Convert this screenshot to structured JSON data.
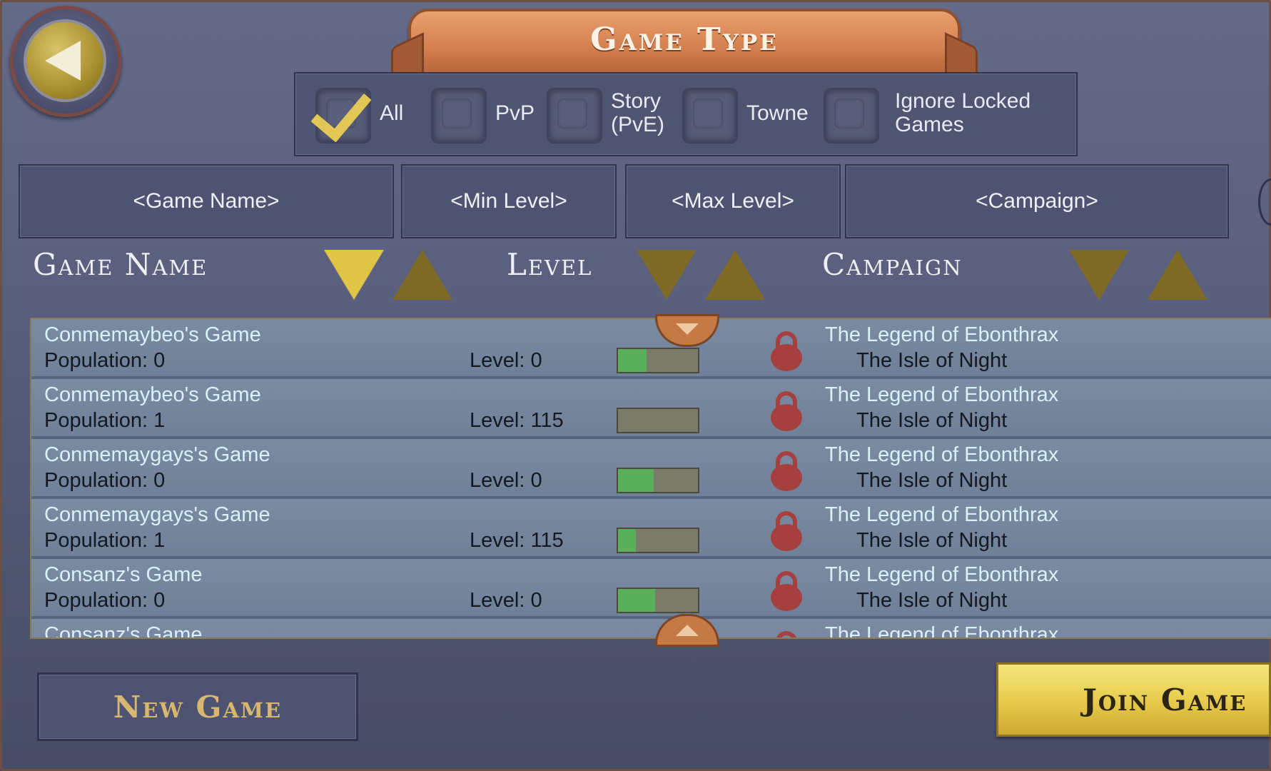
{
  "banner": {
    "title": "Game Type"
  },
  "filters": [
    {
      "label": "All",
      "checked": true
    },
    {
      "label": "PvP",
      "checked": false
    },
    {
      "label": "Story\n(PvE)",
      "checked": false
    },
    {
      "label": "Towne",
      "checked": false
    },
    {
      "label": "Ignore Locked\nGames",
      "checked": false
    }
  ],
  "search": {
    "game_name": "<Game Name>",
    "min_level": "<Min Level>",
    "max_level": "<Max Level>",
    "campaign": "<Campaign>"
  },
  "columns": {
    "game_name": "Game Name",
    "level": "Level",
    "campaign": "Campaign"
  },
  "colors": {
    "accent_gold": "#e0c445",
    "banner_orange": "#d68150",
    "row_bg": "#7485a0",
    "bar_fill": "#5caf5a",
    "lock": "#a5403e"
  },
  "games": [
    {
      "name": "Conmemaybeo's Game",
      "population": "Population: 0",
      "level": "Level: 0",
      "level_fill": 0.36,
      "campaign": "The Legend of Ebonthrax",
      "sub": "The Isle of Night",
      "locked": true
    },
    {
      "name": "Conmemaybeo's Game",
      "population": "Population: 1",
      "level": "Level: 115",
      "level_fill": 0.0,
      "campaign": "The Legend of Ebonthrax",
      "sub": "The Isle of Night",
      "locked": true
    },
    {
      "name": "Conmemaygays's Game",
      "population": "Population: 0",
      "level": "Level: 0",
      "level_fill": 0.45,
      "campaign": "The Legend of Ebonthrax",
      "sub": "The Isle of Night",
      "locked": true
    },
    {
      "name": "Conmemaygays's Game",
      "population": "Population: 1",
      "level": "Level: 115",
      "level_fill": 0.22,
      "campaign": "The Legend of Ebonthrax",
      "sub": "The Isle of Night",
      "locked": true
    },
    {
      "name": "Consanz's Game",
      "population": "Population: 0",
      "level": "Level: 0",
      "level_fill": 0.46,
      "campaign": "The Legend of Ebonthrax",
      "sub": "The Isle of Night",
      "locked": true
    },
    {
      "name": "Consanz's Game",
      "population": "",
      "level": "",
      "level_fill": 0.0,
      "campaign": "The Legend of Ebonthrax",
      "sub": "",
      "locked": true
    }
  ],
  "buttons": {
    "new_game": "New Game",
    "join_game": "Join Game"
  }
}
